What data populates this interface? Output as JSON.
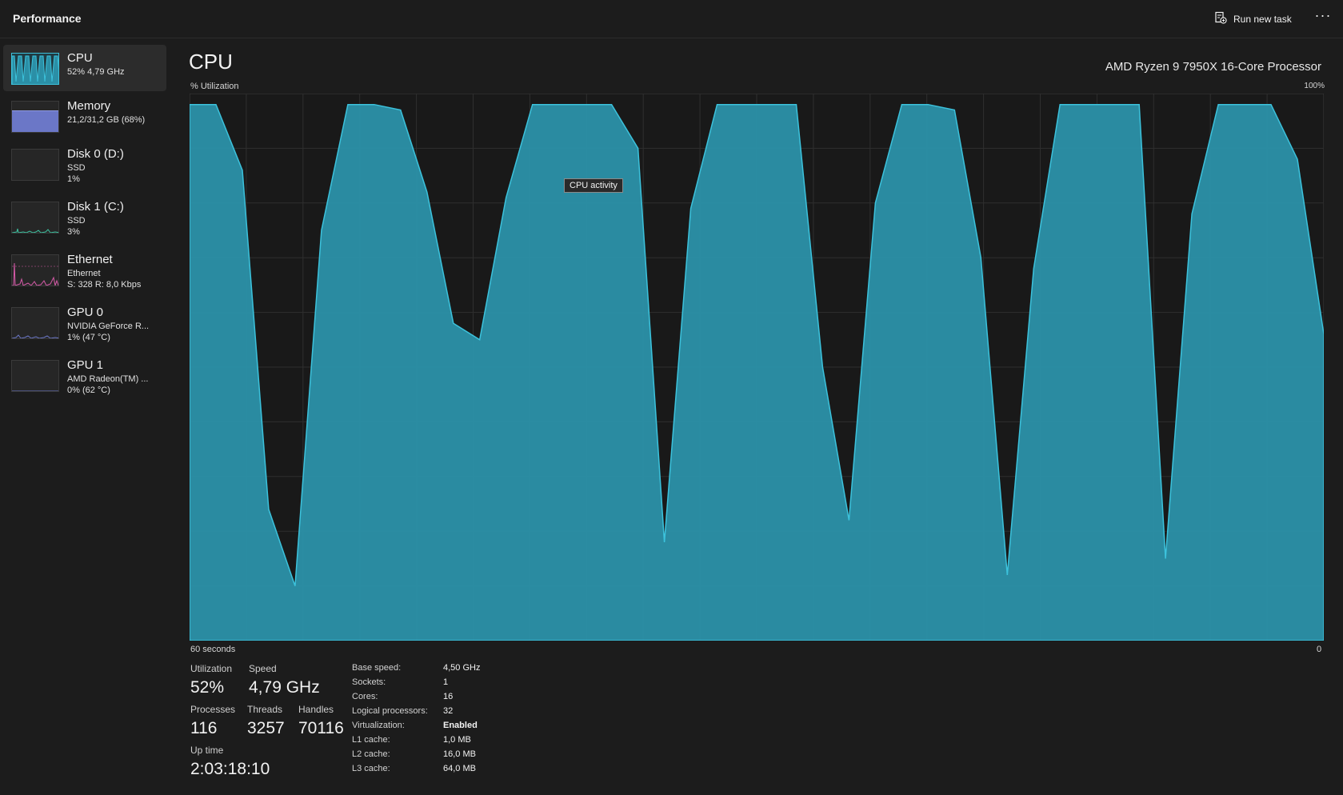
{
  "app": {
    "title": "Performance"
  },
  "toolbar": {
    "run_task_label": "Run new task",
    "more_label": "···"
  },
  "sidebar": {
    "items": [
      {
        "name": "CPU",
        "sub1": "52%  4,79 GHz",
        "sub2": ""
      },
      {
        "name": "Memory",
        "sub1": "21,2/31,2 GB (68%)",
        "sub2": ""
      },
      {
        "name": "Disk 0 (D:)",
        "sub1": "SSD",
        "sub2": "1%"
      },
      {
        "name": "Disk 1 (C:)",
        "sub1": "SSD",
        "sub2": "3%"
      },
      {
        "name": "Ethernet",
        "sub1": "Ethernet",
        "sub2": "S: 328  R: 8,0 Kbps"
      },
      {
        "name": "GPU 0",
        "sub1": "NVIDIA GeForce R...",
        "sub2": "1%  (47 °C)"
      },
      {
        "name": "GPU 1",
        "sub1": "AMD Radeon(TM) ...",
        "sub2": "0%  (62 °C)"
      }
    ]
  },
  "main": {
    "title": "CPU",
    "processor": "AMD Ryzen 9 7950X 16-Core Processor",
    "util_label": "% Utilization",
    "max_label": "100%",
    "time_left": "60 seconds",
    "time_right": "0",
    "tooltip": "CPU activity"
  },
  "stats": {
    "utilization_label": "Utilization",
    "utilization": "52%",
    "speed_label": "Speed",
    "speed": "4,79 GHz",
    "processes_label": "Processes",
    "processes": "116",
    "threads_label": "Threads",
    "threads": "3257",
    "handles_label": "Handles",
    "handles": "70116",
    "uptime_label": "Up time",
    "uptime": "2:03:18:10"
  },
  "specs": [
    {
      "label": "Base speed:",
      "value": "4,50 GHz"
    },
    {
      "label": "Sockets:",
      "value": "1"
    },
    {
      "label": "Cores:",
      "value": "16"
    },
    {
      "label": "Logical processors:",
      "value": "32"
    },
    {
      "label": "Virtualization:",
      "value": "Enabled"
    },
    {
      "label": "L1 cache:",
      "value": "1,0 MB"
    },
    {
      "label": "L2 cache:",
      "value": "16,0 MB"
    },
    {
      "label": "L3 cache:",
      "value": "64,0 MB"
    }
  ],
  "colors": {
    "cpu_fill": "#2b8fa6",
    "cpu_line": "#3cc2dc",
    "memory_fill": "#6b77c7",
    "ethernet_line": "#d65aa8"
  },
  "chart_data": {
    "type": "area",
    "title": "",
    "xlabel": "",
    "ylabel": "% Utilization",
    "xlim": [
      60,
      0
    ],
    "ylim": [
      0,
      100
    ],
    "series": [
      {
        "values": [
          98,
          98,
          86,
          24,
          10,
          75,
          98,
          98,
          97,
          82,
          58,
          55,
          81,
          98,
          98,
          98,
          98,
          90,
          18,
          79,
          98,
          98,
          98,
          98,
          50,
          22,
          80,
          98,
          98,
          97,
          70,
          12,
          68,
          98,
          98,
          98,
          98,
          15,
          78,
          98,
          98,
          98,
          88,
          56
        ]
      }
    ],
    "grid": true
  }
}
